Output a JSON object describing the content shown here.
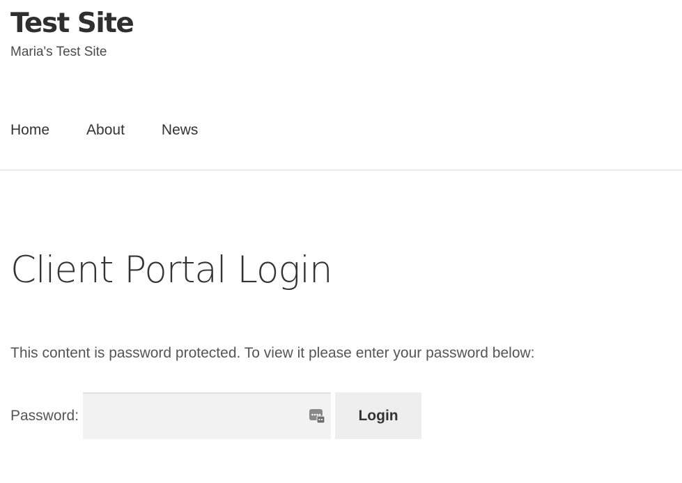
{
  "site": {
    "title": "Test Site",
    "tagline": "Maria's Test Site"
  },
  "nav": {
    "items": [
      {
        "label": "Home"
      },
      {
        "label": "About"
      },
      {
        "label": "News"
      }
    ]
  },
  "page": {
    "title": "Client Portal Login",
    "notice": "This content is password protected. To view it please enter your password below:"
  },
  "form": {
    "password_label": "Password:",
    "password_value": "",
    "password_field_icon": "password-manager-key-icon",
    "submit_label": "Login"
  },
  "colors": {
    "text": "#333333",
    "muted_text": "#555555",
    "input_bg": "#f2f2f2",
    "button_bg": "#eeeeee",
    "divider": "#eaeaea"
  }
}
